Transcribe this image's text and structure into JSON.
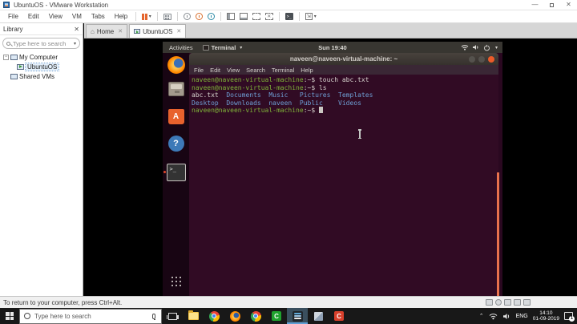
{
  "vmware": {
    "title": "UbuntuOS - VMware Workstation",
    "menu": [
      "File",
      "Edit",
      "View",
      "VM",
      "Tabs",
      "Help"
    ],
    "toolbar_icons": [
      "suspend",
      "ctrl-alt-del",
      "take-snapshot",
      "revert-snapshot",
      "snapshot-manager",
      "show-library",
      "show-thumbnails",
      "fullscreen",
      "unity",
      "console-view",
      "stretch"
    ],
    "window_controls": [
      "minimize",
      "restore",
      "close"
    ],
    "tabs": [
      {
        "label": "Home",
        "active": false
      },
      {
        "label": "UbuntuOS",
        "active": true
      }
    ],
    "library": {
      "title": "Library",
      "search_placeholder": "Type here to search",
      "items": [
        {
          "label": "My Computer"
        },
        {
          "label": "UbuntuOS"
        },
        {
          "label": "Shared VMs"
        }
      ]
    },
    "statusbar": {
      "message": "To return to your computer, press Ctrl+Alt.",
      "device_icons": [
        "hard-disk",
        "cd-rom",
        "network-adapter",
        "usb",
        "sound"
      ]
    }
  },
  "ubuntu": {
    "topbar": {
      "activities": "Activities",
      "focused_app": "Terminal",
      "clock": "Sun 19:40",
      "tray_icons": [
        "network",
        "volume",
        "power",
        "chevron-down"
      ]
    },
    "dock_icons": [
      "firefox",
      "files",
      "ubuntu-software",
      "help",
      "terminal",
      "show-applications"
    ],
    "terminal": {
      "title": "naveen@naveen-virtual-machine: ~",
      "menu": [
        "File",
        "Edit",
        "View",
        "Search",
        "Terminal",
        "Help"
      ],
      "palette": {
        "prompt": "#7fb339",
        "fg": "#d6d2cd",
        "dir": "#6e9fd4"
      },
      "lines": [
        {
          "spans": [
            [
              "prompt",
              "naveen@naveen-virtual-machine"
            ],
            [
              "fg",
              ":~$ "
            ],
            [
              "fg",
              "touch abc.txt"
            ]
          ]
        },
        {
          "spans": [
            [
              "prompt",
              "naveen@naveen-virtual-machine"
            ],
            [
              "fg",
              ":~$ "
            ],
            [
              "fg",
              "ls"
            ]
          ]
        },
        {
          "spans": [
            [
              "fg",
              "abc.txt  "
            ],
            [
              "dir",
              "Documents  "
            ],
            [
              "dir",
              "Music   "
            ],
            [
              "dir",
              "Pictures  "
            ],
            [
              "dir",
              "Templates"
            ]
          ]
        },
        {
          "spans": [
            [
              "dir",
              "Desktop  "
            ],
            [
              "dir",
              "Downloads  "
            ],
            [
              "dir",
              "naveen  "
            ],
            [
              "dir",
              "Public    "
            ],
            [
              "dir",
              "Videos"
            ]
          ]
        },
        {
          "spans": [
            [
              "prompt",
              "naveen@naveen-virtual-machine"
            ],
            [
              "fg",
              ":~$ "
            ]
          ],
          "cursor": true
        }
      ]
    }
  },
  "windows_taskbar": {
    "search_placeholder": "Type here to search",
    "app_icons": [
      "start",
      "task-view",
      "file-explorer",
      "chrome",
      "firefox",
      "chrome-2",
      "camtasia-green",
      "vmware-workstation",
      "prism-app",
      "camtasia-red"
    ],
    "tray": {
      "language": "ENG",
      "time": "14:10",
      "date": "01-09-2019",
      "notification_count": "1"
    }
  }
}
